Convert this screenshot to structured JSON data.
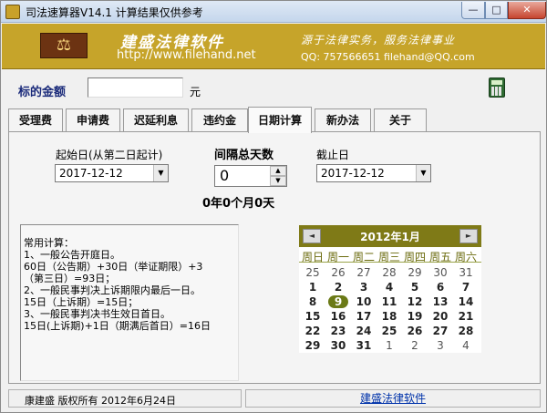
{
  "window": {
    "title": "司法速算器V14.1   计算结果仅供参考",
    "minimize": "—",
    "maximize": "□",
    "close": "✕"
  },
  "banner": {
    "logo_glyph": "⚖",
    "brand": "建盛法律软件",
    "url": "http://www.filehand.net",
    "slogan": "源于法律实务，服务法律事业",
    "contact": "QQ: 757566651  filehand@QQ.com"
  },
  "amount": {
    "label": "标的金额",
    "value": "",
    "unit": "元"
  },
  "tabs": [
    {
      "label": "受理费"
    },
    {
      "label": "申请费"
    },
    {
      "label": "迟延利息"
    },
    {
      "label": "违约金"
    },
    {
      "label": "日期计算"
    },
    {
      "label": "新办法"
    },
    {
      "label": "关于"
    }
  ],
  "active_tab": "日期计算",
  "date_calc": {
    "start_label": "起始日(从第二日起计)",
    "start_value": "2017-12-12",
    "interval_label": "间隔总天数",
    "interval_value": "0",
    "end_label": "截止日",
    "end_value": "2017-12-12",
    "result": "0年0个月0天"
  },
  "notes": [
    "常用计算：",
    "1、一般公告开庭日。",
    "  60日（公告期）+30日（举证期限）+3",
    "（第三日）=93日；",
    "2、一般民事判决上诉期限内最后一日。",
    "  15日（上诉期）=15日；",
    "3、一般民事判决书生效日首日。",
    "  15日(上诉期)+1日（期满后首日）=16日"
  ],
  "calendar": {
    "title": "2012年1月",
    "prev": "◄",
    "next": "►",
    "weekdays": [
      "周日",
      "周一",
      "周二",
      "周三",
      "周四",
      "周五",
      "周六"
    ],
    "weeks": [
      [
        "25",
        "26",
        "27",
        "28",
        "29",
        "30",
        "31"
      ],
      [
        "1",
        "2",
        "3",
        "4",
        "5",
        "6",
        "7"
      ],
      [
        "8",
        "9",
        "10",
        "11",
        "12",
        "13",
        "14"
      ],
      [
        "15",
        "16",
        "17",
        "18",
        "19",
        "20",
        "21"
      ],
      [
        "22",
        "23",
        "24",
        "25",
        "26",
        "27",
        "28"
      ],
      [
        "29",
        "30",
        "31",
        "1",
        "2",
        "3",
        "4"
      ]
    ],
    "today_label": "9",
    "header_color": "#7f7a17"
  },
  "status": {
    "left": "康建盛 版权所有   2012年6月24日",
    "right": "建盛法律软件"
  }
}
